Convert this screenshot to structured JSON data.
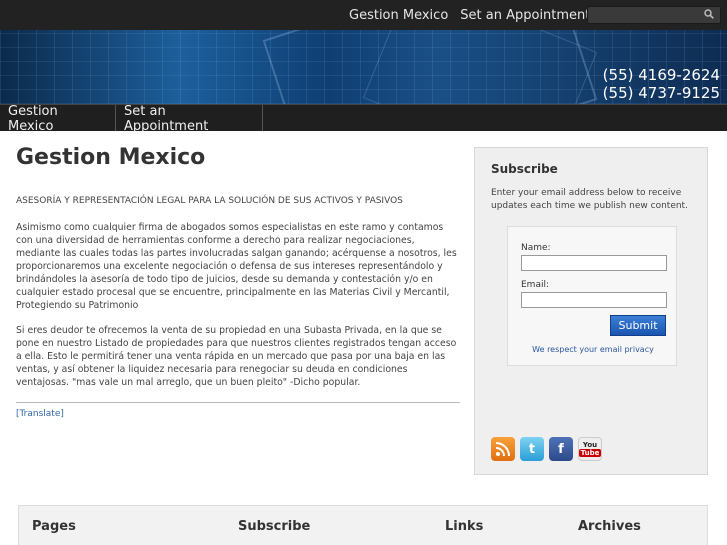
{
  "topnav": {
    "items": [
      "Gestion Mexico",
      "Set an Appointment"
    ],
    "search_placeholder": ""
  },
  "banner": {
    "phones": [
      "(55) 4169-2624",
      "(55) 4737-9125"
    ]
  },
  "mainnav": {
    "items": [
      "Gestion Mexico",
      "Set an Appointment"
    ]
  },
  "page": {
    "title": "Gestion Mexico",
    "subtitle": "ASESORÍA Y REPRESENTACIÓN LEGAL PARA LA SOLUCIÓN DE SUS ACTIVOS Y PASIVOS",
    "paragraph1": "Asimismo como cualquier firma de abogados somos especialistas en este ramo y contamos con una diversidad de herramientas conforme a derecho para realizar negociaciones, mediante las cuales todas las partes involucradas salgan ganando; acérquense a nosotros, les proporcionaremos una excelente negociación o defensa de sus intereses representándolo y brindándoles la asesoría de todo tipo de juicios, desde su demanda y contestación y/o en cualquier estado procesal que se encuentre, principalmente en las Materias Civil y Mercantil, Protegiendo su Patrimonio",
    "paragraph2": "Si eres deudor te ofrecemos la venta de su propiedad en una Subasta Privada, en la que se pone en nuestro Listado de propiedades para que nuestros clientes registrados tengan acceso a ella. Esto le permitirá tener una venta rápida en un mercado que pasa por una baja en las ventas, y así obtener la liquidez necesaria para renegociar su deuda en condiciones ventajosas.  \"mas vale un mal arreglo, que un buen pleito\" -Dicho popular.",
    "translate_link": "[Translate]"
  },
  "sidebar": {
    "title": "Subscribe",
    "description": "Enter your email address below to receive updates each time we publish new content.",
    "name_label": "Name:",
    "email_label": "Email:",
    "submit_label": "Submit",
    "privacy_text": "We respect your email privacy",
    "social": {
      "rss_icon": "rss-icon",
      "twitter_icon": "twitter-icon",
      "facebook_icon": "facebook-icon",
      "youtube_icon": "youtube-icon",
      "youtube_text_top": "You",
      "youtube_text_bottom": "Tube"
    }
  },
  "footer": {
    "columns": [
      "Pages",
      "Subscribe",
      "Links",
      "Archives"
    ]
  },
  "colors": {
    "topbar": "#222222",
    "nav": "#1f1f1f",
    "link": "#3366aa",
    "submit": "#1a55b0"
  }
}
